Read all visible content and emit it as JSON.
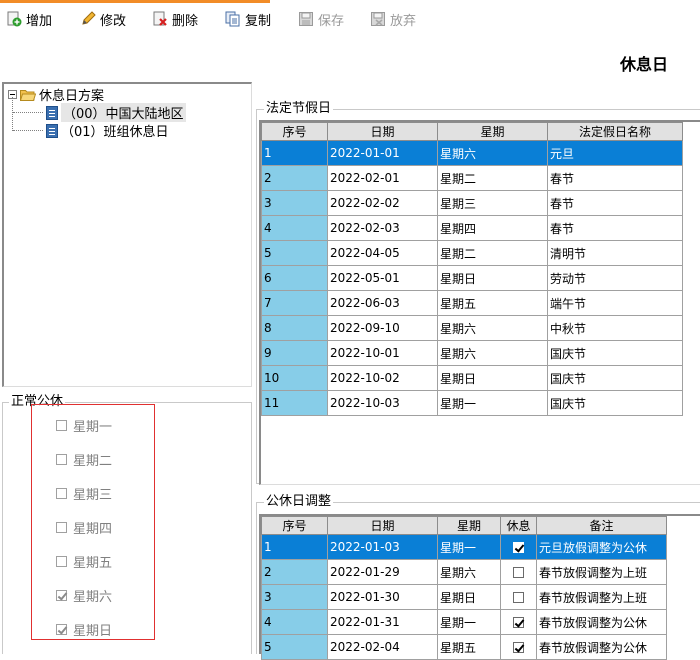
{
  "toolbar": {
    "accent_color": "#f28c28",
    "buttons": [
      {
        "label": "增加",
        "icon": "add-icon",
        "enabled": true
      },
      {
        "label": "修改",
        "icon": "pencil-icon",
        "enabled": true
      },
      {
        "label": "删除",
        "icon": "delete-icon",
        "enabled": true
      },
      {
        "label": "复制",
        "icon": "copy-icon",
        "enabled": true
      },
      {
        "label": "保存",
        "icon": "save-icon",
        "enabled": false
      },
      {
        "label": "放弃",
        "icon": "discard-icon",
        "enabled": false
      }
    ]
  },
  "page_title": "休息日",
  "tree": {
    "root": "休息日方案",
    "children": [
      "（00）中国大陆地区",
      "（01）班组休息日"
    ],
    "selected_index": 0
  },
  "weekly": {
    "title": "正常公休",
    "days": [
      {
        "label": "星期一",
        "checked": false
      },
      {
        "label": "星期二",
        "checked": false
      },
      {
        "label": "星期三",
        "checked": false
      },
      {
        "label": "星期四",
        "checked": false
      },
      {
        "label": "星期五",
        "checked": false
      },
      {
        "label": "星期六",
        "checked": true
      },
      {
        "label": "星期日",
        "checked": true
      }
    ]
  },
  "holidays": {
    "title": "法定节假日",
    "columns": [
      "序号",
      "日期",
      "星期",
      "法定假日名称"
    ],
    "rows": [
      [
        "1",
        "2022-01-01",
        "星期六",
        "元旦"
      ],
      [
        "2",
        "2022-02-01",
        "星期二",
        "春节"
      ],
      [
        "3",
        "2022-02-02",
        "星期三",
        "春节"
      ],
      [
        "4",
        "2022-02-03",
        "星期四",
        "春节"
      ],
      [
        "5",
        "2022-04-05",
        "星期二",
        "清明节"
      ],
      [
        "6",
        "2022-05-01",
        "星期日",
        "劳动节"
      ],
      [
        "7",
        "2022-06-03",
        "星期五",
        "端午节"
      ],
      [
        "8",
        "2022-09-10",
        "星期六",
        "中秋节"
      ],
      [
        "9",
        "2022-10-01",
        "星期六",
        "国庆节"
      ],
      [
        "10",
        "2022-10-02",
        "星期日",
        "国庆节"
      ],
      [
        "11",
        "2022-10-03",
        "星期一",
        "国庆节"
      ]
    ],
    "selected_row": 0
  },
  "adjust": {
    "title": "公休日调整",
    "columns": [
      "序号",
      "日期",
      "星期",
      "休息",
      "备注"
    ],
    "rows": [
      {
        "no": "1",
        "date": "2022-01-03",
        "weekday": "星期一",
        "rest": true,
        "note": "元旦放假调整为公休"
      },
      {
        "no": "2",
        "date": "2022-01-29",
        "weekday": "星期六",
        "rest": false,
        "note": "春节放假调整为上班"
      },
      {
        "no": "3",
        "date": "2022-01-30",
        "weekday": "星期日",
        "rest": false,
        "note": "春节放假调整为上班"
      },
      {
        "no": "4",
        "date": "2022-01-31",
        "weekday": "星期一",
        "rest": true,
        "note": "春节放假调整为公休"
      },
      {
        "no": "5",
        "date": "2022-02-04",
        "weekday": "星期五",
        "rest": true,
        "note": "春节放假调整为公休"
      }
    ],
    "selected_row": 0
  },
  "colors": {
    "selected_row": "#0a7fd6",
    "index_cell": "#87cde8",
    "header": "#e1e1e1",
    "highlight_border": "#e03030"
  }
}
